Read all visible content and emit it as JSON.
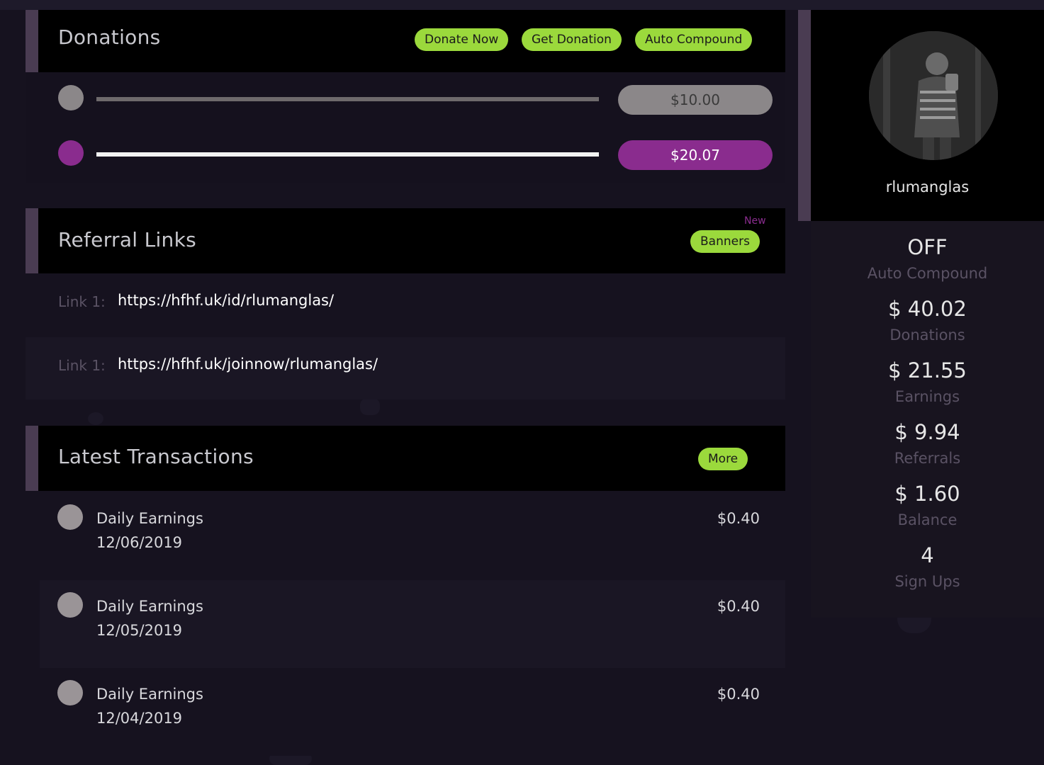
{
  "donations": {
    "title": "Donations",
    "buttons": {
      "donate_now": "Donate Now",
      "get_donation": "Get Donation",
      "auto_compound": "Auto Compound"
    },
    "rows": [
      {
        "amount": "$10.00",
        "color": "#8b8789",
        "track_color": "#6e6a6c"
      },
      {
        "amount": "$20.07",
        "color": "#8a2c8e",
        "track_color": "#f2f2f2"
      }
    ]
  },
  "referral": {
    "title": "Referral Links",
    "new_badge": "New",
    "banners_label": "Banners",
    "links": [
      {
        "label": "Link 1:",
        "url": "https://hfhf.uk/id/rlumanglas/"
      },
      {
        "label": "Link 1:",
        "url": "https://hfhf.uk/joinnow/rlumanglas/"
      }
    ]
  },
  "transactions": {
    "title": "Latest Transactions",
    "more_label": "More",
    "items": [
      {
        "title": "Daily Earnings",
        "date": "12/06/2019",
        "amount": "$0.40"
      },
      {
        "title": "Daily Earnings",
        "date": "12/05/2019",
        "amount": "$0.40"
      },
      {
        "title": "Daily Earnings",
        "date": "12/04/2019",
        "amount": "$0.40"
      }
    ]
  },
  "profile": {
    "username": "rlumanglas",
    "stats": [
      {
        "value": "OFF",
        "label": "Auto Compound"
      },
      {
        "value": "$ 40.02",
        "label": "Donations"
      },
      {
        "value": "$ 21.55",
        "label": "Earnings"
      },
      {
        "value": "$ 9.94",
        "label": "Referrals"
      },
      {
        "value": "$ 1.60",
        "label": "Balance"
      },
      {
        "value": "4",
        "label": "Sign Ups"
      }
    ]
  },
  "colors": {
    "accent_green": "#9bd93c",
    "accent_purple": "#8a2c8e",
    "background": "#16121f"
  }
}
